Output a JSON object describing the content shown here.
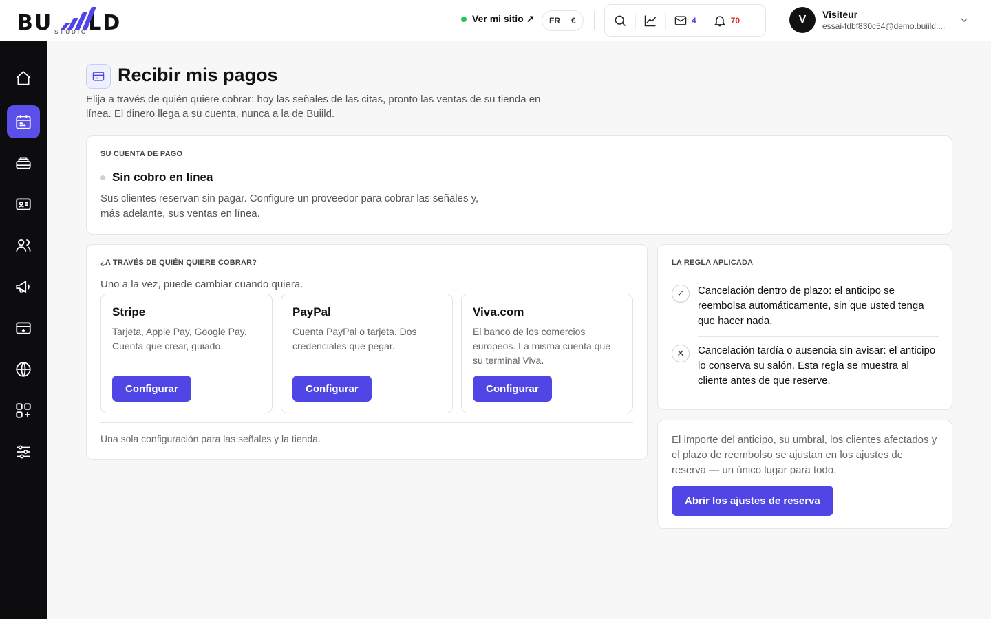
{
  "brand": {
    "logo_letters_left": "BU",
    "logo_letters_right": "LD",
    "logo_sub": "STUDIO"
  },
  "topbar": {
    "site_link": "Ver mi sitio ↗",
    "lang": "FR",
    "currency": "€",
    "mail_count": "4",
    "notif_count": "70"
  },
  "user": {
    "initial": "V",
    "name": "Visiteur",
    "email": "essai-fdbf830c54@demo.buiild...."
  },
  "sidebar": {
    "items": [
      "home-icon",
      "calendar-icon",
      "cash-register-icon",
      "contact-card-icon",
      "users-icon",
      "megaphone-icon",
      "payment-card-icon",
      "globe-icon",
      "apps-icon",
      "sliders-icon"
    ],
    "active_index": 1,
    "accent": "#5b4fe9"
  },
  "page": {
    "title": "Recibir mis pagos",
    "description": "Elija a través de quién quiere cobrar: hoy las señales de las citas, pronto las ventas de su tienda en línea. El dinero llega a su cuenta, nunca a la de Buiild."
  },
  "account": {
    "label": "SU CUENTA DE PAGO",
    "status": "Sin cobro en línea",
    "description": "Sus clientes reservan sin pagar. Configure un proveedor para cobrar las señales y, más adelante, sus ventas en línea."
  },
  "providers_section": {
    "label": "¿A TRAVÉS DE QUIÉN QUIERE COBRAR?",
    "subtitle": "Uno a la vez, puede cambiar cuando quiera.",
    "providers": [
      {
        "name": "Stripe",
        "description": "Tarjeta, Apple Pay, Google Pay. Cuenta que crear, guiado.",
        "button": "Configurar"
      },
      {
        "name": "PayPal",
        "description": "Cuenta PayPal o tarjeta. Dos credenciales que pegar.",
        "button": "Configurar"
      },
      {
        "name": "Viva.com",
        "description": "El banco de los comercios europeos. La misma cuenta que su terminal Viva.",
        "button": "Configurar"
      }
    ],
    "footer": "Una sola configuración para las señales y la tienda."
  },
  "rule": {
    "label": "LA REGLA APLICADA",
    "items": [
      {
        "icon": "✓",
        "text": "Cancelación dentro de plazo: el anticipo se reembolsa automáticamente, sin que usted tenga que hacer nada."
      },
      {
        "icon": "✕",
        "text": "Cancelación tardía o ausencia sin avisar: el anticipo lo conserva su salón. Esta regla se muestra al cliente antes de que reserve."
      }
    ]
  },
  "settings_card": {
    "text": "El importe del anticipo, su umbral, los clientes afectados y el plazo de reembolso se ajustan en los ajustes de reserva — un único lugar para todo.",
    "button": "Abrir los ajustes de reserva"
  },
  "colors": {
    "primary": "#4f46e5",
    "online_dot": "#22c55e",
    "notif_red": "#dc2626"
  }
}
